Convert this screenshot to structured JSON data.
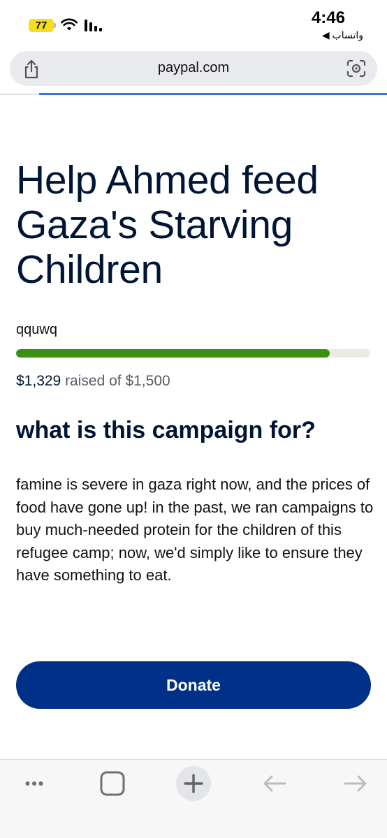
{
  "status_bar": {
    "battery": "77",
    "time": "4:46",
    "back_app": "◀ واتساب"
  },
  "browser": {
    "url": "paypal.com"
  },
  "campaign": {
    "title": "Help Ahmed feed Gaza's Starving Children",
    "organizer": "qquwq",
    "raised_amount": "$1,329",
    "raised_text": " raised of $1,500",
    "progress_fraction": 0.886,
    "section_heading": "what is this campaign for?",
    "description": "famine is severe in gaza right now, and the prices of food have gone up! in the past, we ran campaigns to buy much-needed protein for the children of this refugee camp; now, we'd simply like to ensure they have something to eat."
  },
  "donate": {
    "label": "Donate"
  },
  "colors": {
    "brand_navy": "#003087",
    "heading": "#001435",
    "progress_green": "#3b8f12",
    "battery_yellow": "#f5de1a",
    "load_bar_blue": "#2d7be5"
  },
  "toolbar": {
    "icons": [
      "more-icon",
      "tabs-icon",
      "new-tab-icon",
      "back-arrow-icon",
      "forward-arrow-icon"
    ]
  }
}
